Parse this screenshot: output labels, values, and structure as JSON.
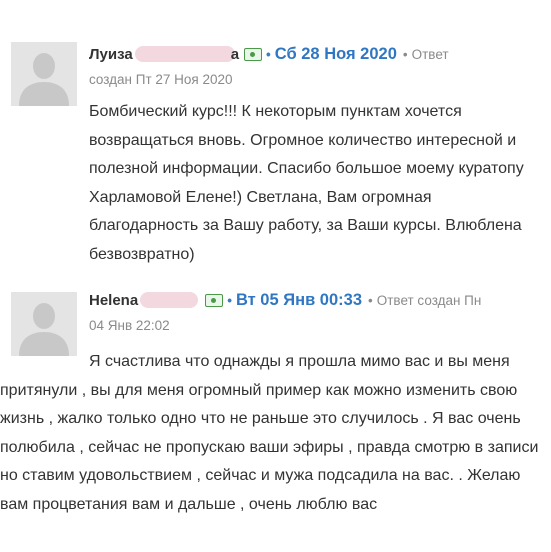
{
  "reviews": [
    {
      "author": "Луиза",
      "name_tail": "а",
      "date": "Сб 28 Ноя 2020",
      "reply_label": "Ответ",
      "created": "создан Пт 27 Ноя 2020",
      "text": "Бомбический курс!!! К некоторым пунктам хочется возвращаться вновь. Огромное количество интересной и полезной информации. Спасибо большое моему куратопу Харламовой Елене!) Светлана, Вам огромная благодарность за Вашу работу, за Ваши курсы. Влюблена безвозвратно)"
    },
    {
      "author": "Helena",
      "date": "Вт 05 Янв 00:33",
      "reply_label": "Ответ создан Пн",
      "created": "04 Янв 22:02",
      "text": "Я счастлива что однажды я прошла мимо вас и вы меня притянули , вы для меня огромный пример как можно изменить свою жизнь , жалко только одно что не раньше это случилось . Я вас очень полюбила , сейчас не пропускаю ваши эфиры , правда смотрю в записи но ставим удовольствием , сейчас и мужа подсадила на вас. . Желаю вам процветания вам и дальше , очень люблю вас"
    }
  ],
  "icons": {
    "avatar": "user-silhouette-icon",
    "money": "money-icon"
  },
  "colors": {
    "date": "#2f77c2",
    "money_icon": "#4a9a4a",
    "blur": "#f3d9df"
  }
}
